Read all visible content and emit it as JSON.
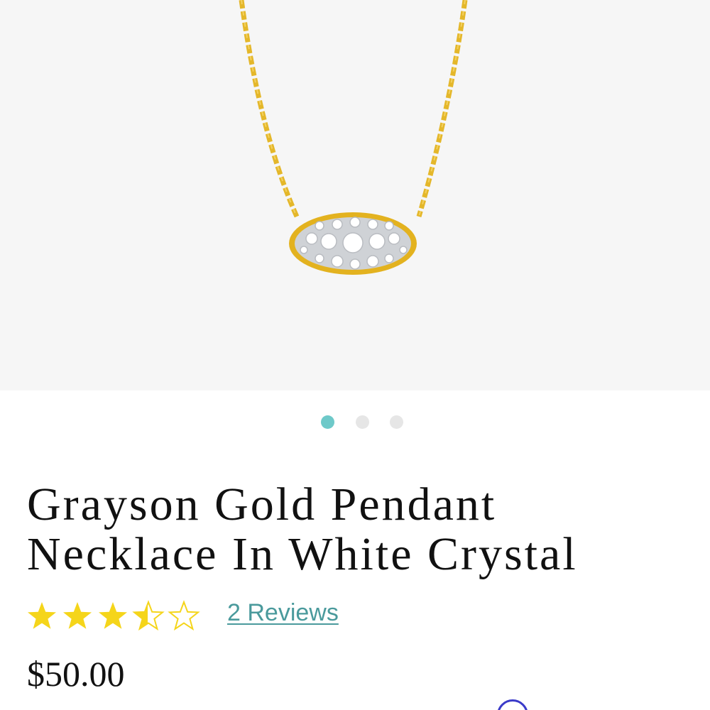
{
  "product": {
    "title": "Grayson Gold Pendant Necklace In White Crystal",
    "rating": 3.5,
    "rating_max": 5,
    "reviews_label": "2 Reviews",
    "price": "$50.00"
  },
  "gallery": {
    "image_count": 3,
    "active_index": 0
  },
  "colors": {
    "gold": "#e8b923",
    "star": "#f5d51a",
    "active_dot": "#6ec9c9",
    "link": "#4a9a9c"
  }
}
